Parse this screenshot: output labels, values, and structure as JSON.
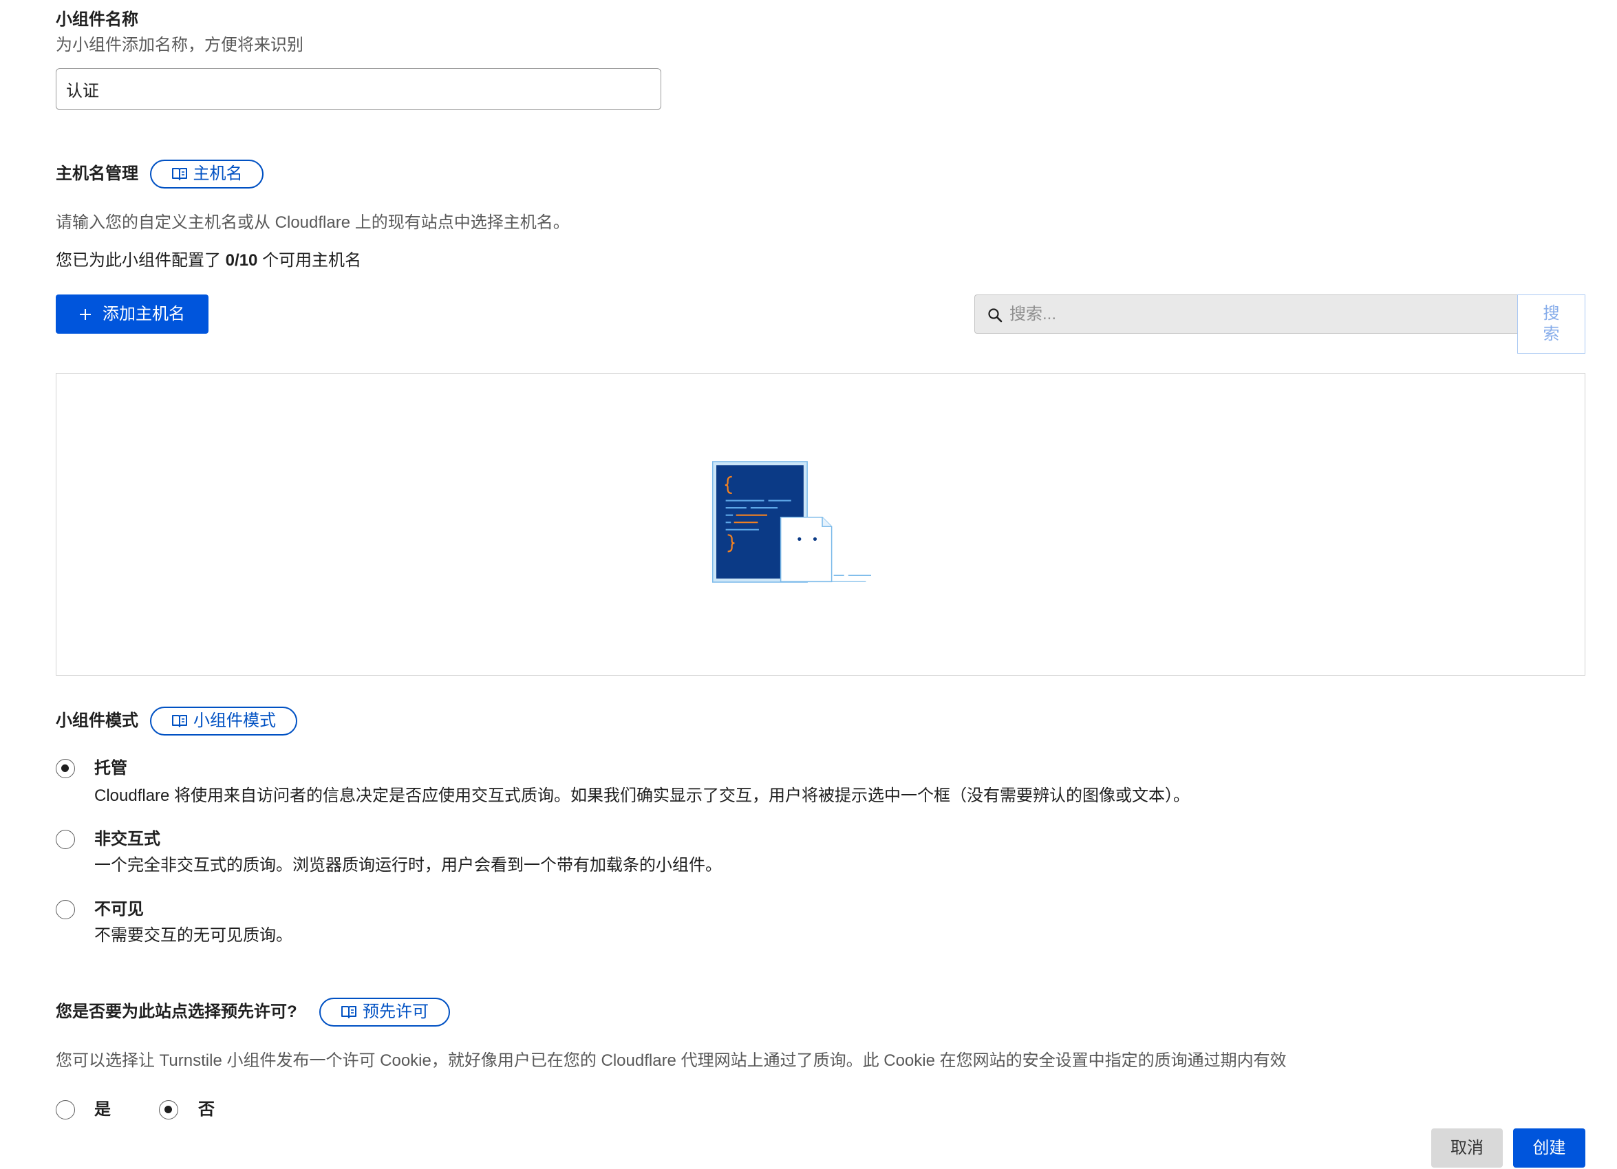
{
  "widget_name": {
    "label": "小组件名称",
    "hint": "为小组件添加名称，方便将来识别",
    "value": "认证"
  },
  "hostnames": {
    "label": "主机名管理",
    "doc_link": "主机名",
    "description": "请输入您的自定义主机名或从 Cloudflare 上的现有站点中选择主机名。",
    "count_prefix": "您已为此小组件配置了",
    "count": "0/10",
    "count_suffix": "个可用主机名",
    "add_button": "添加主机名",
    "search_placeholder": "搜索...",
    "search_button": "搜索"
  },
  "mode": {
    "label": "小组件模式",
    "doc_link": "小组件模式",
    "options": [
      {
        "title": "托管",
        "description": "Cloudflare 将使用来自访问者的信息决定是否应使用交互式质询。如果我们确实显示了交互，用户将被提示选中一个框（没有需要辨认的图像或文本）。",
        "selected": true
      },
      {
        "title": "非交互式",
        "description": "一个完全非交互式的质询。浏览器质询运行时，用户会看到一个带有加载条的小组件。",
        "selected": false
      },
      {
        "title": "不可见",
        "description": "不需要交互的无可见质询。",
        "selected": false
      }
    ]
  },
  "preclearance": {
    "label": "您是否要为此站点选择预先许可?",
    "doc_link": "预先许可",
    "description": "您可以选择让 Turnstile 小组件发布一个许可 Cookie，就好像用户已在您的 Cloudflare 代理网站上通过了质询。此 Cookie 在您网站的安全设置中指定的质询通过期内有效",
    "options": [
      {
        "label": "是",
        "selected": false
      },
      {
        "label": "否",
        "selected": true
      }
    ]
  },
  "footer": {
    "cancel": "取消",
    "create": "创建"
  },
  "icons": {
    "doc_link": "book-icon",
    "add": "plus-icon",
    "search": "search-icon",
    "empty_state": "code-document-illustration"
  },
  "colors": {
    "primary_button": "#0055dc",
    "link": "#0051c3",
    "muted_text": "#595959",
    "search_background": "#e9e9e9"
  }
}
